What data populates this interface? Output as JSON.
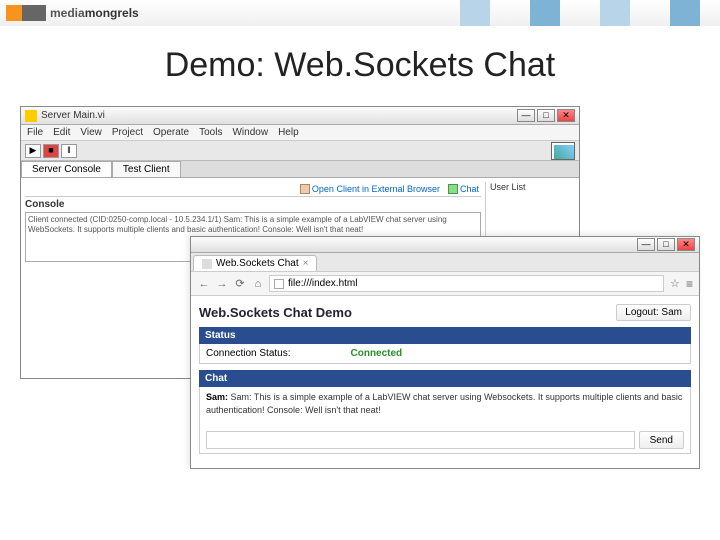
{
  "brand": {
    "media": "media",
    "mongrels": "mongrels"
  },
  "slide_title": "Demo: Web.Sockets Chat",
  "labview": {
    "title": "Server Main.vi",
    "menu": [
      "File",
      "Edit",
      "View",
      "Project",
      "Operate",
      "Tools",
      "Window",
      "Help"
    ],
    "tabs": {
      "active": "Server Console",
      "other": "Test Client"
    },
    "actions": {
      "open_browser": "Open Client in External Browser",
      "chat": "Chat"
    },
    "console_label": "Console",
    "console_lines": "Client connected (CID:0250-comp.local - 10.5.234.1/1)\nSam: This is a simple example of a LabVIEW chat server using WebSockets. It supports multiple clients and basic authentication!\nConsole: Well isn't that neat!",
    "userlist_label": "User List"
  },
  "browser": {
    "tab_title": "Web.Sockets Chat",
    "url": "file:///index.html",
    "page_title": "Web.Sockets Chat Demo",
    "logout": "Logout: Sam",
    "status_section": "Status",
    "status_label": "Connection Status:",
    "status_value": "Connected",
    "chat_section": "Chat",
    "chat_messages_html": "Sam: This is a simple example of a LabVIEW chat server using Websockets. It supports multiple clients and basic authentication!\nConsole: Well isn't that neat!",
    "send_label": "Send"
  }
}
